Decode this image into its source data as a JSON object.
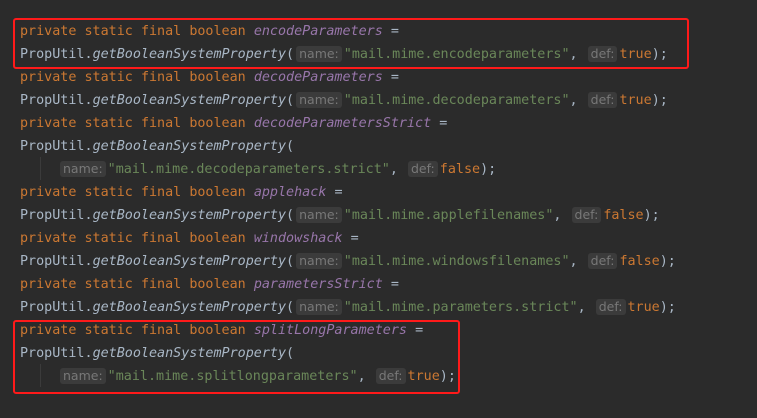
{
  "decl": {
    "private": "private",
    "static": "static",
    "final": "final",
    "type": "boolean"
  },
  "call": {
    "cls": "PropUtil",
    "dot": ".",
    "method": "getBooleanSystemProperty"
  },
  "hints": {
    "name": "name:",
    "def": "def:"
  },
  "punct": {
    "eq": "=",
    "paren": "(",
    "comma": ",",
    "close": ");"
  },
  "fields": [
    {
      "name": "encodeParameters",
      "prop": "\"mail.mime.encodeparameters\"",
      "def": "true"
    },
    {
      "name": "decodeParameters",
      "prop": "\"mail.mime.decodeparameters\"",
      "def": "true"
    },
    {
      "name": "decodeParametersStrict",
      "prop": "\"mail.mime.decodeparameters.strict\"",
      "def": "false"
    },
    {
      "name": "applehack",
      "prop": "\"mail.mime.applefilenames\"",
      "def": "false"
    },
    {
      "name": "windowshack",
      "prop": "\"mail.mime.windowsfilenames\"",
      "def": "false"
    },
    {
      "name": "parametersStrict",
      "prop": "\"mail.mime.parameters.strict\"",
      "def": "true"
    },
    {
      "name": "splitLongParameters",
      "prop": "\"mail.mime.splitlongparameters\"",
      "def": "true"
    }
  ]
}
